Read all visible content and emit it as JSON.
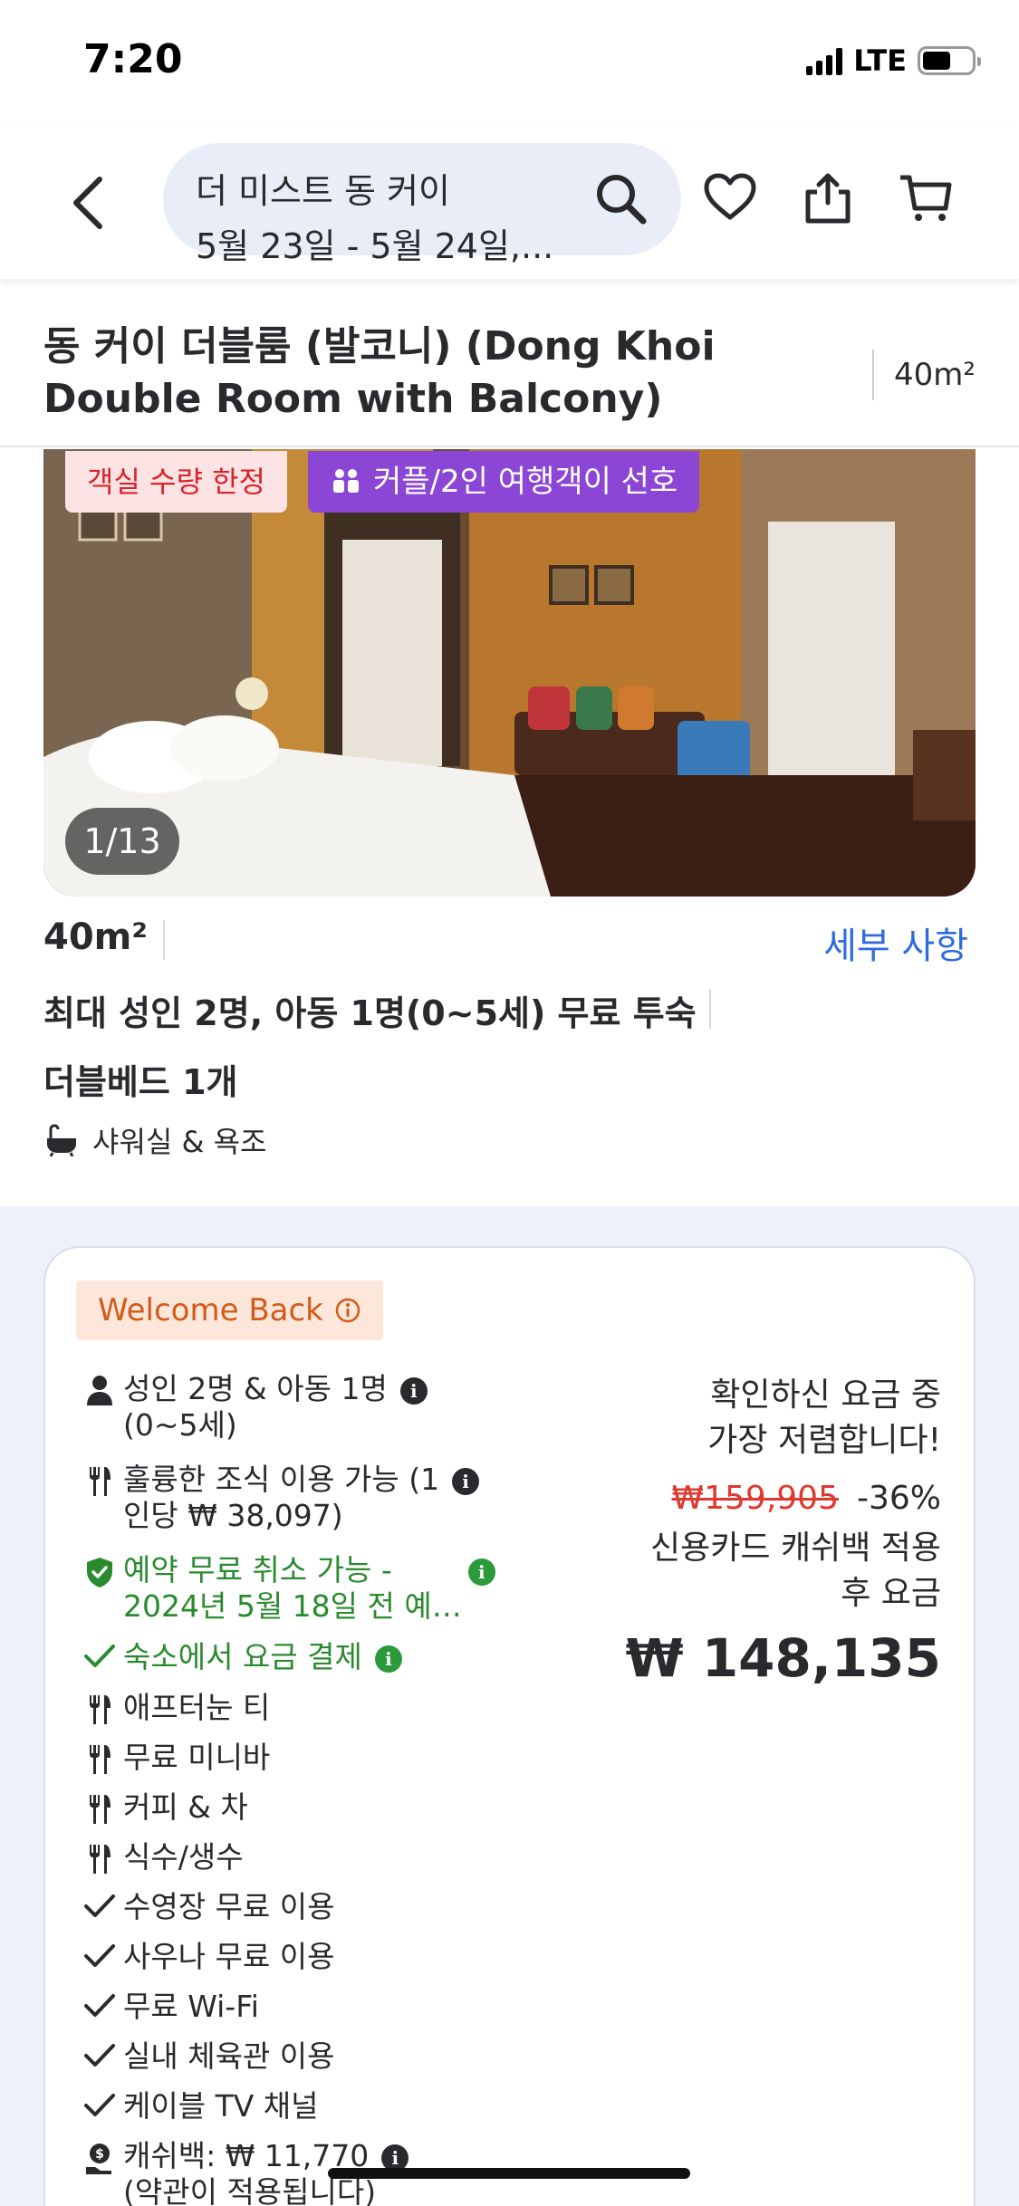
{
  "status_bar": {
    "time": "7:20",
    "network": "LTE"
  },
  "search": {
    "hotel_name": "더 미스트 동 커이",
    "dates": "5월 23일 - 5월 24일,..."
  },
  "room": {
    "title": "동 커이 더블룸 (발코니) (Dong Khoi Double Room with Balcony)",
    "size": "40m²",
    "badges": {
      "limited": "객실 수량 한정",
      "couple": "커플/2인 여행객이 선호"
    },
    "photo_counter": "1/13",
    "details_link": "세부 사항",
    "occupancy": "최대 성인 2명, 아동 1명(0~5세) 무료 투숙",
    "bed": "더블베드 1개",
    "bathroom": "샤워실 & 욕조"
  },
  "offer": {
    "welcome_badge": "Welcome Back",
    "perks": [
      {
        "icon": "person-icon",
        "line1": "성인 2명 & 아동 1명",
        "line2": "(0~5세)",
        "info": true,
        "green": false
      },
      {
        "icon": "fork-knife-icon",
        "line1": "훌륭한 조식 이용 가능 (1",
        "line2": "인당 ₩ 38,097)",
        "info": true,
        "green": false
      },
      {
        "icon": "shield-check-icon",
        "line1": "예약 무료 취소 가능 -",
        "line2": "2024년 5월 18일 전 예…",
        "info": true,
        "green": true
      },
      {
        "icon": "check-icon",
        "line1": "숙소에서 요금 결제",
        "line2": "",
        "info": true,
        "green": true
      },
      {
        "icon": "fork-knife-icon",
        "line1": "애프터눈 티",
        "line2": "",
        "info": false,
        "green": false
      },
      {
        "icon": "fork-knife-icon",
        "line1": "무료 미니바",
        "line2": "",
        "info": false,
        "green": false
      },
      {
        "icon": "fork-knife-icon",
        "line1": "커피 & 차",
        "line2": "",
        "info": false,
        "green": false
      },
      {
        "icon": "fork-knife-icon",
        "line1": "식수/생수",
        "line2": "",
        "info": false,
        "green": false
      },
      {
        "icon": "check-icon",
        "line1": "수영장 무료 이용",
        "line2": "",
        "info": false,
        "green": false
      },
      {
        "icon": "check-icon",
        "line1": "사우나 무료 이용",
        "line2": "",
        "info": false,
        "green": false
      },
      {
        "icon": "check-icon",
        "line1": "무료 Wi-Fi",
        "line2": "",
        "info": false,
        "green": false
      },
      {
        "icon": "check-icon",
        "line1": "실내 체육관 이용",
        "line2": "",
        "info": false,
        "green": false
      },
      {
        "icon": "check-icon",
        "line1": "케이블 TV 채널",
        "line2": "",
        "info": false,
        "green": false
      },
      {
        "icon": "cashback-icon",
        "line1": "캐쉬백: ₩ 11,770",
        "line2": "(약관이 적용됩니다)",
        "info": true,
        "green": false
      }
    ],
    "price": {
      "note_line1": "확인하신 요금 중",
      "note_line2": "가장 저렴합니다!",
      "original": "₩159,905",
      "discount": "-36%",
      "label_line1": "신용카드 캐쉬백 적용",
      "label_line2": "후 요금",
      "final": "₩ 148,135"
    }
  },
  "colors": {
    "accent_blue": "#2f6bdf",
    "green": "#2a8a2e",
    "red": "#e0392f",
    "purple": "#8c46d6",
    "orange": "#d35a18"
  }
}
